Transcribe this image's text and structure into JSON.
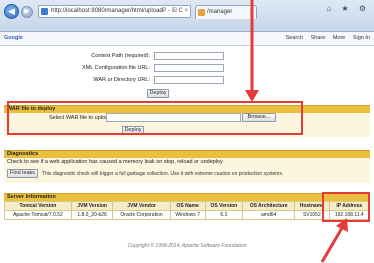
{
  "browser": {
    "address": "http://localhost:8080/manager/html/upload",
    "address_controls": "P - ☒ C ×",
    "tab_label": "/manager",
    "tab_close": "×",
    "window_controls": "⌂ ★ ⚙"
  },
  "toolbar": {
    "brand": "Google",
    "items": [
      "Search",
      "Share",
      "More",
      "Sign In"
    ]
  },
  "deploy": {
    "context_path_label": "Context Path (required):",
    "xml_config_label": "XML Configuration file URL:",
    "war_dir_label": "WAR or Directory URL:",
    "deploy_button": "Deploy"
  },
  "war_section": {
    "heading": "WAR file to deploy",
    "select_label": "Select WAR file to upload",
    "browse_button": "Browse...",
    "deploy_button": "Deploy"
  },
  "diagnostics": {
    "heading": "Diagnostics",
    "text": "Check to see if a web application has caused a memory leak on stop, reload or undeploy",
    "find_leaks_button": "Find leaks",
    "description": "This diagnostic check will trigger a full garbage collection. Use it with extreme caution on production systems."
  },
  "server": {
    "heading": "Server Information",
    "columns": [
      "Tomcat Version",
      "JVM Version",
      "JVM Vendor",
      "OS Name",
      "OS Version",
      "OS Architecture",
      "Hostname",
      "IP Address"
    ],
    "row": [
      "Apache Tomcat/7.0.52",
      "1.8.0_20-b26",
      "Oracle Corporation",
      "Windows 7",
      "6.1",
      "amd64",
      "SV1052",
      "192.168.11.4"
    ]
  },
  "footer": "Copyright © 1999-2014, Apache Software Foundation",
  "colors": {
    "section_header": "#e9bf3d",
    "highlight": "#e53a3a"
  }
}
